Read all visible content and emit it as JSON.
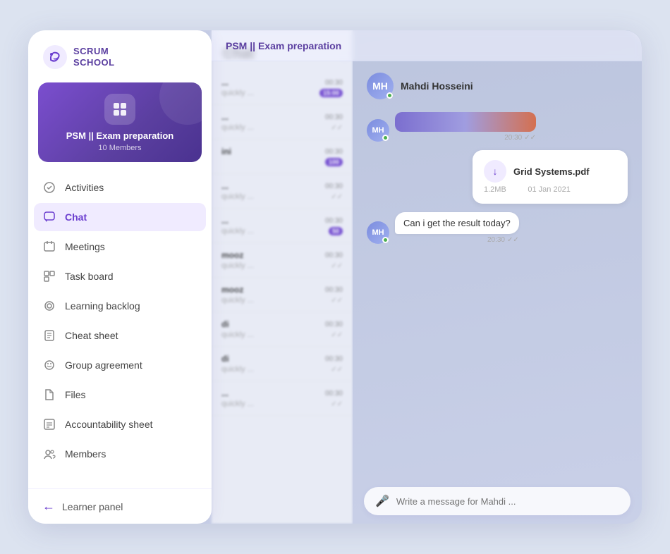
{
  "app": {
    "title": "Scrum School"
  },
  "header": {
    "breadcrumb": "PSM || Exam preparation"
  },
  "sidebar": {
    "logo": {
      "text": "SCRUM\nSCHOOL"
    },
    "group_card": {
      "title": "PSM || Exam preparation",
      "members": "10 Members"
    },
    "nav_items": [
      {
        "label": "Activities",
        "icon": "activities-icon",
        "active": false
      },
      {
        "label": "Chat",
        "icon": "chat-icon",
        "active": true
      },
      {
        "label": "Meetings",
        "icon": "meetings-icon",
        "active": false
      },
      {
        "label": "Task board",
        "icon": "taskboard-icon",
        "active": false
      },
      {
        "label": "Learning backlog",
        "icon": "learning-icon",
        "active": false
      },
      {
        "label": "Cheat sheet",
        "icon": "cheatsheet-icon",
        "active": false
      },
      {
        "label": "Group agreement",
        "icon": "agreement-icon",
        "active": false
      },
      {
        "label": "Files",
        "icon": "files-icon",
        "active": false
      },
      {
        "label": "Accountability sheet",
        "icon": "accountability-icon",
        "active": false
      },
      {
        "label": "Members",
        "icon": "members-icon",
        "active": false
      }
    ],
    "footer": {
      "label": "Learner panel"
    }
  },
  "chat_list": {
    "header": "Chat",
    "items": [
      {
        "name": "...",
        "time": "00:30",
        "preview": "quickly ...",
        "badge": "15:00",
        "badge_type": "time"
      },
      {
        "name": "...",
        "time": "00:30",
        "preview": "quickly ...",
        "badge": "",
        "badge_type": "check"
      },
      {
        "name": "ini",
        "time": "00:30",
        "preview": "",
        "badge": "100",
        "badge_type": "count"
      },
      {
        "name": "...",
        "time": "00:30",
        "preview": "quickly ...",
        "badge": "",
        "badge_type": "check"
      },
      {
        "name": "...",
        "time": "00:30",
        "preview": "quickly ...",
        "badge": "50",
        "badge_type": "count"
      },
      {
        "name": "mooz",
        "time": "00:30",
        "preview": "quickly ...",
        "badge": "",
        "badge_type": "check"
      },
      {
        "name": "mooz",
        "time": "00:30",
        "preview": "quickly ...",
        "badge": "",
        "badge_type": "check"
      },
      {
        "name": "di",
        "time": "00:30",
        "preview": "quickly ...",
        "badge": "",
        "badge_type": "check"
      },
      {
        "name": "di",
        "time": "00:30",
        "preview": "quickly ...",
        "badge": "",
        "badge_type": "check"
      },
      {
        "name": "...",
        "time": "00:30",
        "preview": "quickly ...",
        "badge": "",
        "badge_type": "check"
      }
    ]
  },
  "main_chat": {
    "recipient_name": "Mahdi Hosseini",
    "messages": [
      {
        "type": "received",
        "content_type": "image",
        "time": "20:30",
        "ticks": "double"
      },
      {
        "type": "sent",
        "content_type": "file",
        "file_name": "Grid Systems.pdf",
        "file_size": "1.2MB",
        "file_date": "01 Jan 2021",
        "time": "",
        "ticks": ""
      },
      {
        "type": "received",
        "content_type": "text",
        "text": "Can i get the result today?",
        "time": "20:30",
        "ticks": "double"
      }
    ],
    "input": {
      "placeholder": "Write a message for Mahdi ..."
    }
  },
  "decorations": {
    "dots_color": "rgba(150,160,210,0.6)"
  }
}
